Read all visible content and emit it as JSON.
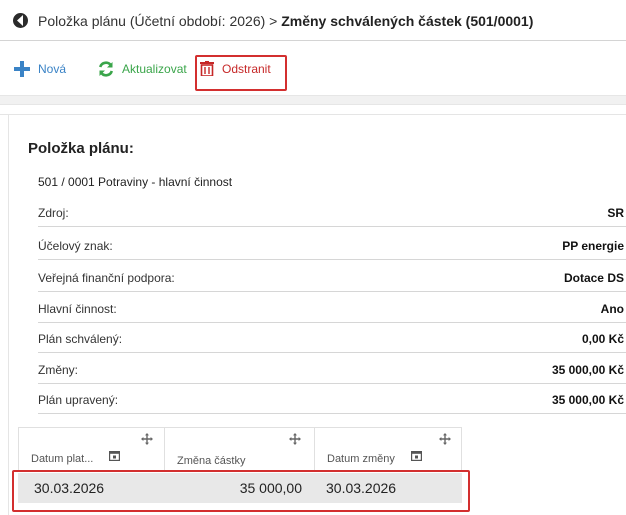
{
  "header": {
    "title_prefix": "Položka plánu (Účetní období: 2026) > ",
    "title_bold": "Změny schválených částek (501/0001)"
  },
  "toolbar": {
    "new_label": "Nová",
    "refresh_label": "Aktualizovat",
    "delete_label": "Odstranit"
  },
  "detail": {
    "section_title": "Položka plánu:",
    "plan_id": "501 / 0001  Potraviny - hlavní činnost",
    "properties": [
      {
        "label": "Zdroj:",
        "value": "SR"
      },
      {
        "label": "Účelový znak:",
        "value": "PP energie"
      },
      {
        "label": "Veřejná finanční podpora:",
        "value": "Dotace DS"
      },
      {
        "label": "Hlavní činnost:",
        "value": "Ano"
      },
      {
        "label": "Plán schválený:",
        "value": "0,00 Kč"
      },
      {
        "label": "Změny:",
        "value": "35 000,00 Kč"
      },
      {
        "label": "Plán upravený:",
        "value": "35 000,00 Kč"
      }
    ]
  },
  "grid": {
    "columns": [
      "Datum plat...",
      "Změna částky",
      "Datum změny"
    ],
    "rows": [
      {
        "datum_plat": "30.03.2026",
        "zmena_castky": "35 000,00",
        "datum_zmeny": "30.03.2026"
      }
    ]
  },
  "colors": {
    "accent_blue": "#3a83c6",
    "accent_green": "#3aa54a",
    "danger_red": "#c62828",
    "highlight_box": "#d32f2f"
  }
}
